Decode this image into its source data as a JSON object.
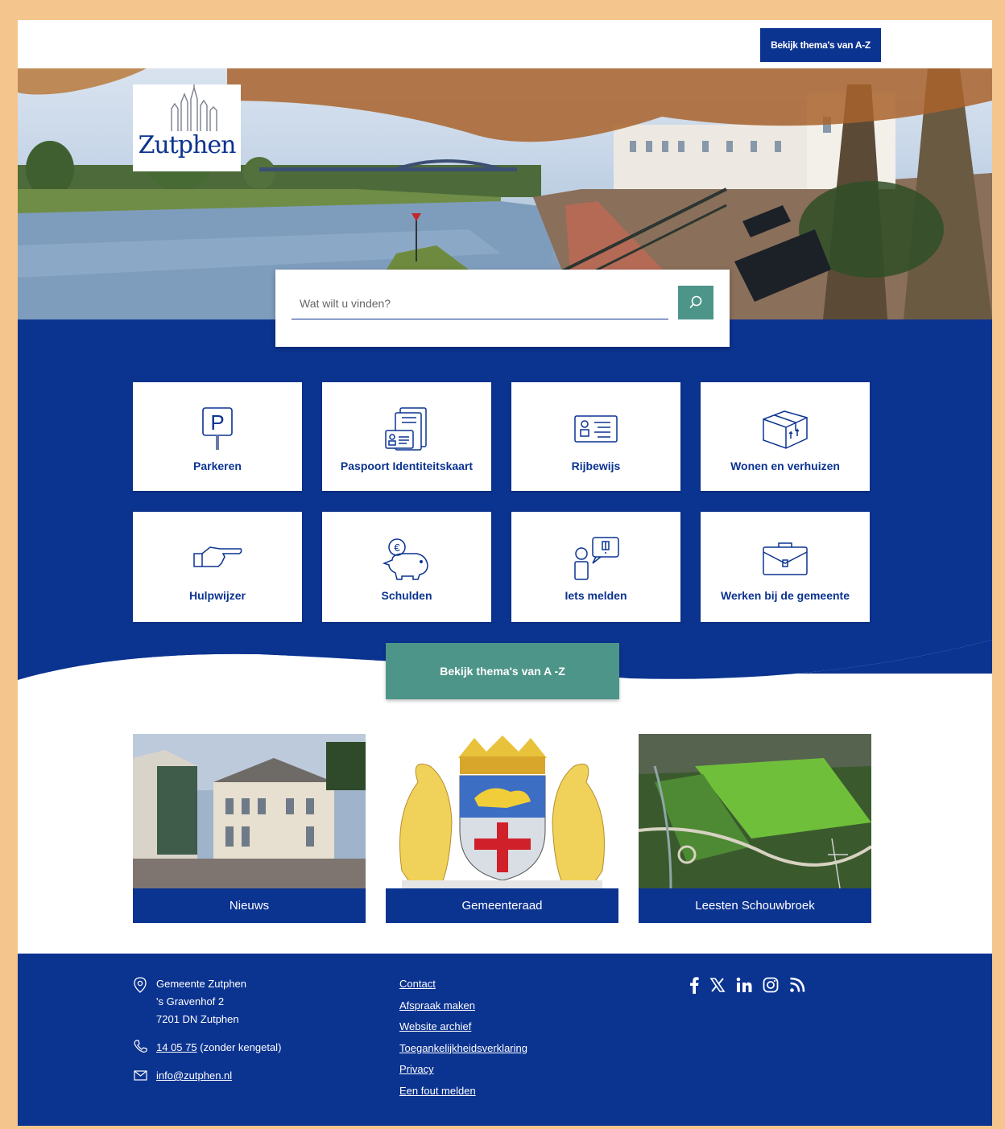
{
  "header": {
    "az_button": "Bekijk thema's van A-Z",
    "logo_text": "Zutphen"
  },
  "search": {
    "placeholder": "Wat wilt u vinden?"
  },
  "tiles": [
    {
      "label": "Parkeren",
      "icon": "parking-sign-icon"
    },
    {
      "label": "Paspoort Identiteitskaart",
      "icon": "passport-id-icon"
    },
    {
      "label": "Rijbewijs",
      "icon": "drivers-license-icon"
    },
    {
      "label": "Wonen en verhuizen",
      "icon": "moving-box-icon"
    },
    {
      "label": "Hulpwijzer",
      "icon": "pointing-hand-icon"
    },
    {
      "label": "Schulden",
      "icon": "piggy-bank-icon"
    },
    {
      "label": "Iets melden",
      "icon": "report-speech-icon"
    },
    {
      "label": "Werken bij de gemeente",
      "icon": "briefcase-icon"
    }
  ],
  "az_teal_button": "Bekijk thema's van A -Z",
  "cards": [
    {
      "caption": "Nieuws"
    },
    {
      "caption": "Gemeenteraad"
    },
    {
      "caption": "Leesten Schouwbroek"
    }
  ],
  "footer": {
    "address": {
      "name": "Gemeente Zutphen",
      "street": "'s Gravenhof 2",
      "city": "7201 DN Zutphen"
    },
    "phone": {
      "number": "14 05 75",
      "note": "(zonder kengetal)"
    },
    "email": "info@zutphen.nl",
    "links": [
      "Contact",
      "Afspraak maken",
      "Website archief",
      "Toegankelijkheidsverklaring",
      "Privacy",
      "Een fout melden"
    ],
    "social": [
      "facebook-icon",
      "x-icon",
      "linkedin-icon",
      "instagram-icon",
      "rss-icon"
    ]
  },
  "colors": {
    "primary_blue": "#0b3390",
    "teal": "#4e9589",
    "page_border": "#f5c58e"
  }
}
